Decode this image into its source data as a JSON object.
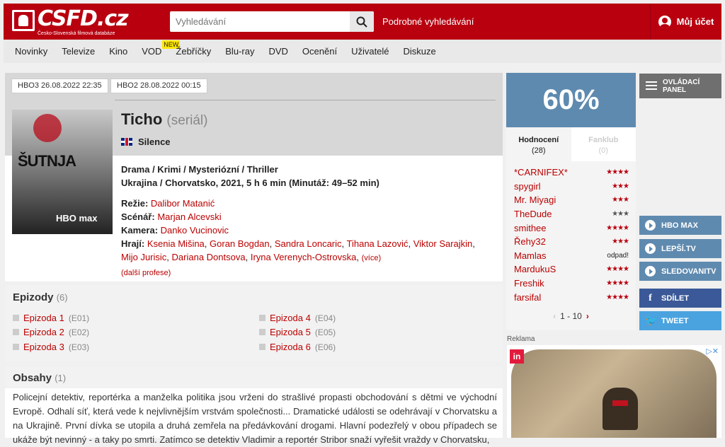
{
  "header": {
    "logo_text": "CSFD.cz",
    "logo_tagline": "Česko-Slovenská filmová databáze",
    "search_placeholder": "Vyhledávání",
    "advanced_search": "Podrobné vyhledávání",
    "account": "Můj účet",
    "brand_color": "#b8000f"
  },
  "nav": {
    "items": [
      "Novinky",
      "Televize",
      "Kino",
      "VOD",
      "Žebříčky",
      "Blu-ray",
      "DVD",
      "Ocenění",
      "Uživatelé",
      "Diskuze"
    ],
    "vod_badge": "NEW"
  },
  "film": {
    "tv_slots": [
      "HBO3 26.08.2022 22:35",
      "HBO2 28.08.2022 00:15"
    ],
    "poster_title": "ŠUTNJA",
    "poster_network": "HBO max",
    "title": "Ticho",
    "type": "(seriál)",
    "original_title": "Silence",
    "genres": "Drama / Krimi / Mysteriózní / Thriller",
    "origin": "Ukrajina / Chorvatsko, 2021, 5 h 6 min (Minutáž: 49–52 min)",
    "directing_label": "Režie:",
    "director": "Dalibor Matanić",
    "writing_label": "Scénář:",
    "writer": "Marjan Alcevski",
    "camera_label": "Kamera:",
    "camera": "Danko Vucinovic",
    "cast_label": "Hrají:",
    "cast": [
      "Ksenia Mišina",
      "Goran Bogdan",
      "Sandra Loncaric",
      "Tihana Lazović",
      "Viktor Sarajkin",
      "Mijo Jurisic",
      "Dariana Dontsova",
      "Iryna Verenych-Ostrovska"
    ],
    "more": "(více)",
    "more_professions": "(další profese)"
  },
  "episodes": {
    "heading": "Epizody",
    "count": "(6)",
    "items": [
      {
        "name": "Epizoda 1",
        "code": "(E01)"
      },
      {
        "name": "Epizoda 2",
        "code": "(E02)"
      },
      {
        "name": "Epizoda 3",
        "code": "(E03)"
      },
      {
        "name": "Epizoda 4",
        "code": "(E04)"
      },
      {
        "name": "Epizoda 5",
        "code": "(E05)"
      },
      {
        "name": "Epizoda 6",
        "code": "(E06)"
      }
    ]
  },
  "plot": {
    "heading": "Obsahy",
    "count": "(1)",
    "text": "Policejní detektiv, reportérka a manželka politika jsou vrženi do strašlivé propasti obchodování s dětmi ve východní Evropě. Odhalí síť, která vede k nejvlivnějším vrstvám společnosti... Dramatické události se odehrávají v Chorvatsku a na Ukrajině. První dívka se utopila a druhá zemřela na předávkování drogami. Hlavní podezřelý v obou případech se ukáže být nevinný - a taky po smrti. Zatímco se detektiv Vladimir a reportér Stribor snaží vyřešit vraždy v Chorvatsku,"
  },
  "rating": {
    "value": "60%",
    "tab_ratings": "Hodnocení",
    "tab_ratings_count": "(28)",
    "tab_fanclub": "Fanklub",
    "tab_fanclub_count": "(0)",
    "users": [
      {
        "name": "*CARNIFEX*",
        "stars": "★★★★",
        "dim": false
      },
      {
        "name": "spygirl",
        "stars": "★★★",
        "dim": false
      },
      {
        "name": "Mr. Miyagi",
        "stars": "★★★",
        "dim": false
      },
      {
        "name": "TheDude",
        "stars": "★★★",
        "dim": true
      },
      {
        "name": "smithee",
        "stars": "★★★★",
        "dim": false
      },
      {
        "name": "Řehy32",
        "stars": "★★★",
        "dim": false
      },
      {
        "name": "Mamlas",
        "stars": "odpad!",
        "dim": false
      },
      {
        "name": "MardukuS",
        "stars": "★★★★",
        "dim": false
      },
      {
        "name": "Freshik",
        "stars": "★★★★",
        "dim": false
      },
      {
        "name": "farsifal",
        "stars": "★★★★",
        "dim": false
      }
    ],
    "pager": "1 - 10",
    "accent": "#5f8aaf"
  },
  "side": {
    "control_panel": "OVLÁDACÍ PANEL",
    "buttons": [
      {
        "label": "HBO MAX",
        "icon": "play-icon",
        "color": "#5f8aaf"
      },
      {
        "label": "LEPŠÍ.TV",
        "icon": "play-icon",
        "color": "#5f8aaf"
      },
      {
        "label": "SLEDOVANITV",
        "icon": "play-icon",
        "color": "#5f8aaf"
      },
      {
        "label": "SDÍLET",
        "icon": "facebook-icon",
        "color": "#3b5998"
      },
      {
        "label": "TWEET",
        "icon": "twitter-icon",
        "color": "#4aa3df"
      }
    ],
    "ad_label": "Reklama"
  }
}
